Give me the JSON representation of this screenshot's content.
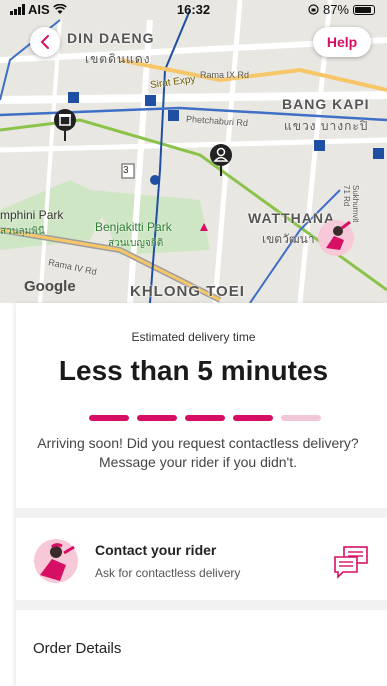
{
  "status_bar": {
    "carrier": "AIS",
    "time": "16:32",
    "battery": "87%"
  },
  "map": {
    "labels": {
      "din_daeng": "DIN DAENG",
      "din_daeng_th": "เขตดินแดง",
      "bang_kapi": "BANG KAPI",
      "bang_kapi_th": "แขวง บางกะปิ",
      "wattana": "WATTHANA",
      "wattana_th": "เขตวัฒนา",
      "khlong_toei": "KHLONG TOEI",
      "lumphini": "mphini Park",
      "lumphini_th": "สวนลุมพินี",
      "benjakitti": "Benjakitti Park",
      "benjakitti_th": "สวนเบญจกิติ",
      "sirat": "Sirat Expy",
      "rama9": "Rama IX Rd",
      "phetchaburi": "Phetchaburi Rd",
      "rama4": "Rama IV Rd",
      "sukhumvit": "Sukhumvit 71 Rd",
      "road_num": "3",
      "google": "Google"
    }
  },
  "header": {
    "back_icon": "chevron-left-icon",
    "help_label": "Help"
  },
  "delivery": {
    "eta_label": "Estimated delivery time",
    "eta_value": "Less than 5 minutes",
    "progress_total": 5,
    "progress_done": 4,
    "message": "Arriving soon! Did you request contactless delivery? Message your rider if you didn't."
  },
  "rider": {
    "title": "Contact your rider",
    "subtitle": "Ask for contactless delivery"
  },
  "order": {
    "title": "Order Details"
  },
  "colors": {
    "accent": "#d70f64",
    "accent_light": "#f2c7d8"
  }
}
